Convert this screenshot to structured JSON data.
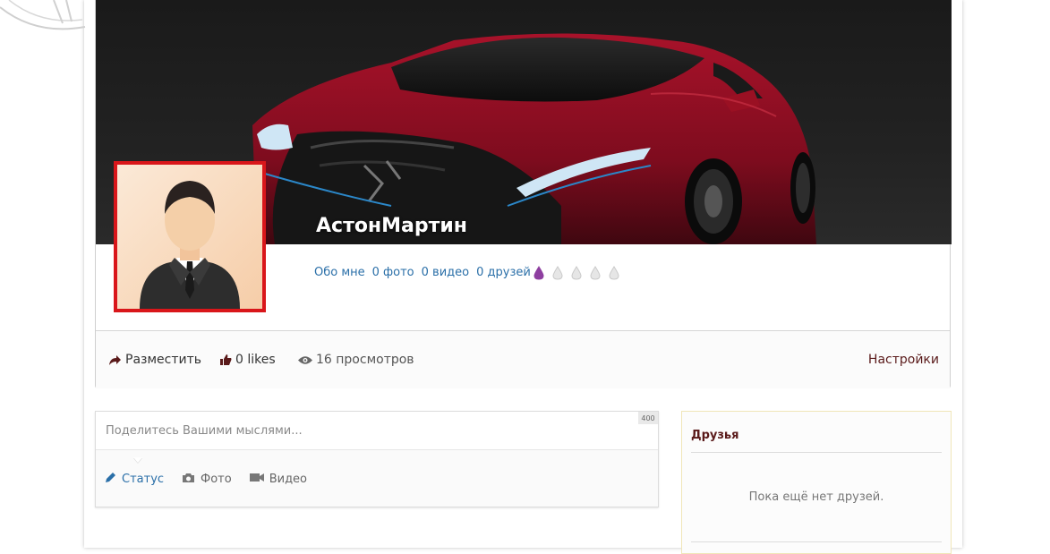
{
  "profile": {
    "username": "АстонМартин",
    "links": [
      {
        "label": "Обо мне"
      },
      {
        "label": "0 фото"
      },
      {
        "label": "0 видео"
      },
      {
        "label": "0 друзей"
      }
    ],
    "rating": {
      "filled": 1,
      "total": 5,
      "filled_color": "#8e3fa0",
      "empty_color": "#c9c9c9"
    }
  },
  "actions": {
    "share_label": "Разместить",
    "likes_label": "0 likes",
    "views_label": "16 просмотров",
    "settings_label": "Настройки"
  },
  "post": {
    "placeholder": "Поделитесь Вашими мыслями...",
    "char_limit": "400",
    "tabs": [
      {
        "label": "Статус",
        "icon": "pencil-icon",
        "active": true
      },
      {
        "label": "Фото",
        "icon": "camera-icon",
        "active": false
      },
      {
        "label": "Видео",
        "icon": "video-camera-icon",
        "active": false
      }
    ]
  },
  "friends": {
    "title": "Друзья",
    "empty_text": "Пока ещё нет друзей."
  },
  "colors": {
    "link": "#2a6fa8",
    "avatar_border": "#d9161a",
    "accent_dark_red": "#5a1a1a"
  }
}
